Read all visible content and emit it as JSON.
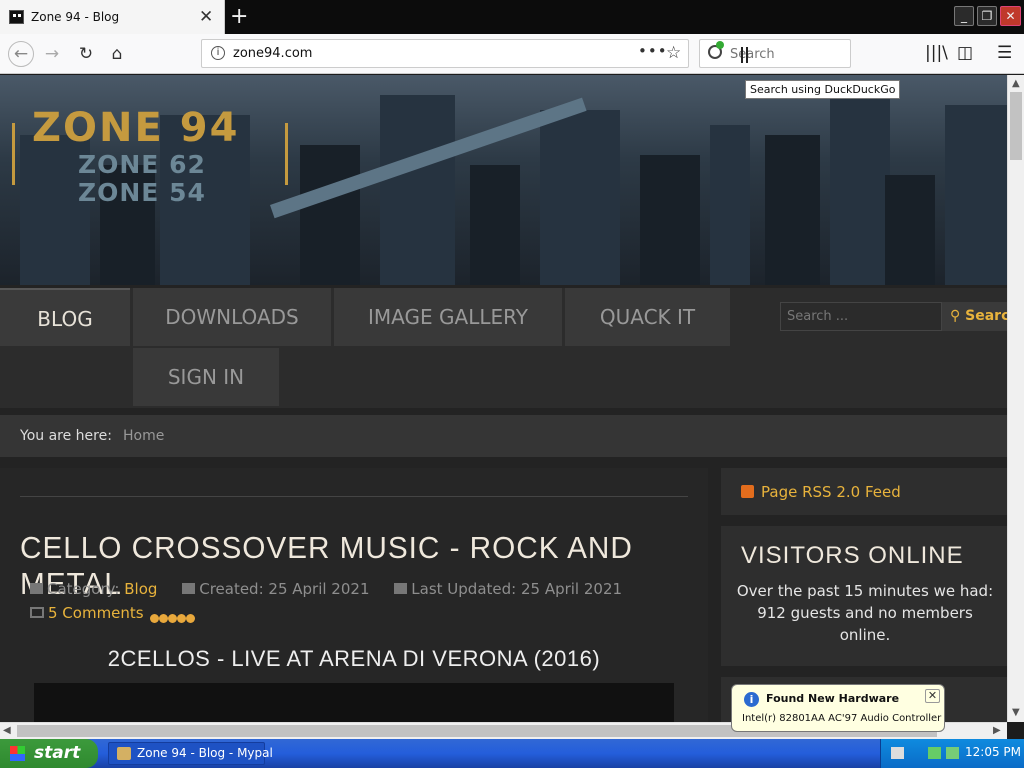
{
  "browser": {
    "tab_title": "Zone 94 - Blog",
    "url": "zone94.com",
    "search_placeholder": "Search",
    "search_tooltip": "Search using DuckDuckGo"
  },
  "site": {
    "logo_main": "ZONE 94",
    "logo_sub1": "ZONE 62",
    "logo_sub2": "ZONE 54",
    "nav": [
      "BLOG",
      "DOWNLOADS",
      "IMAGE GALLERY",
      "QUACK IT",
      "SIGN IN"
    ],
    "search_placeholder": "Search ...",
    "search_button": "Search",
    "breadcrumb_label": "You are here:",
    "breadcrumb_home": "Home"
  },
  "article": {
    "title": "CELLO CROSSOVER MUSIC - ROCK AND METAL",
    "category_label": "Category:",
    "category": "Blog",
    "created": "Created: 25 April 2021",
    "updated": "Last Updated: 25 April 2021",
    "comments": "5 Comments",
    "rating": 5,
    "subheading": "2CELLOS - LIVE AT ARENA DI VERONA (2016)"
  },
  "sidebar": {
    "rss": "Page RSS 2.0 Feed",
    "visitors_title": "VISITORS ONLINE",
    "visitors_text": "Over the past 15 minutes we had: 912 guests and no members online."
  },
  "taskbar": {
    "start": "start",
    "task": "Zone 94 - Blog - Mypal",
    "clock": "12:05 PM"
  },
  "balloon": {
    "title": "Found New Hardware",
    "body": "Intel(r) 82801AA AC'97 Audio Controller"
  },
  "colors": {
    "accent": "#e8b33c",
    "page_bg": "#232323",
    "taskbar": "#245edb"
  }
}
